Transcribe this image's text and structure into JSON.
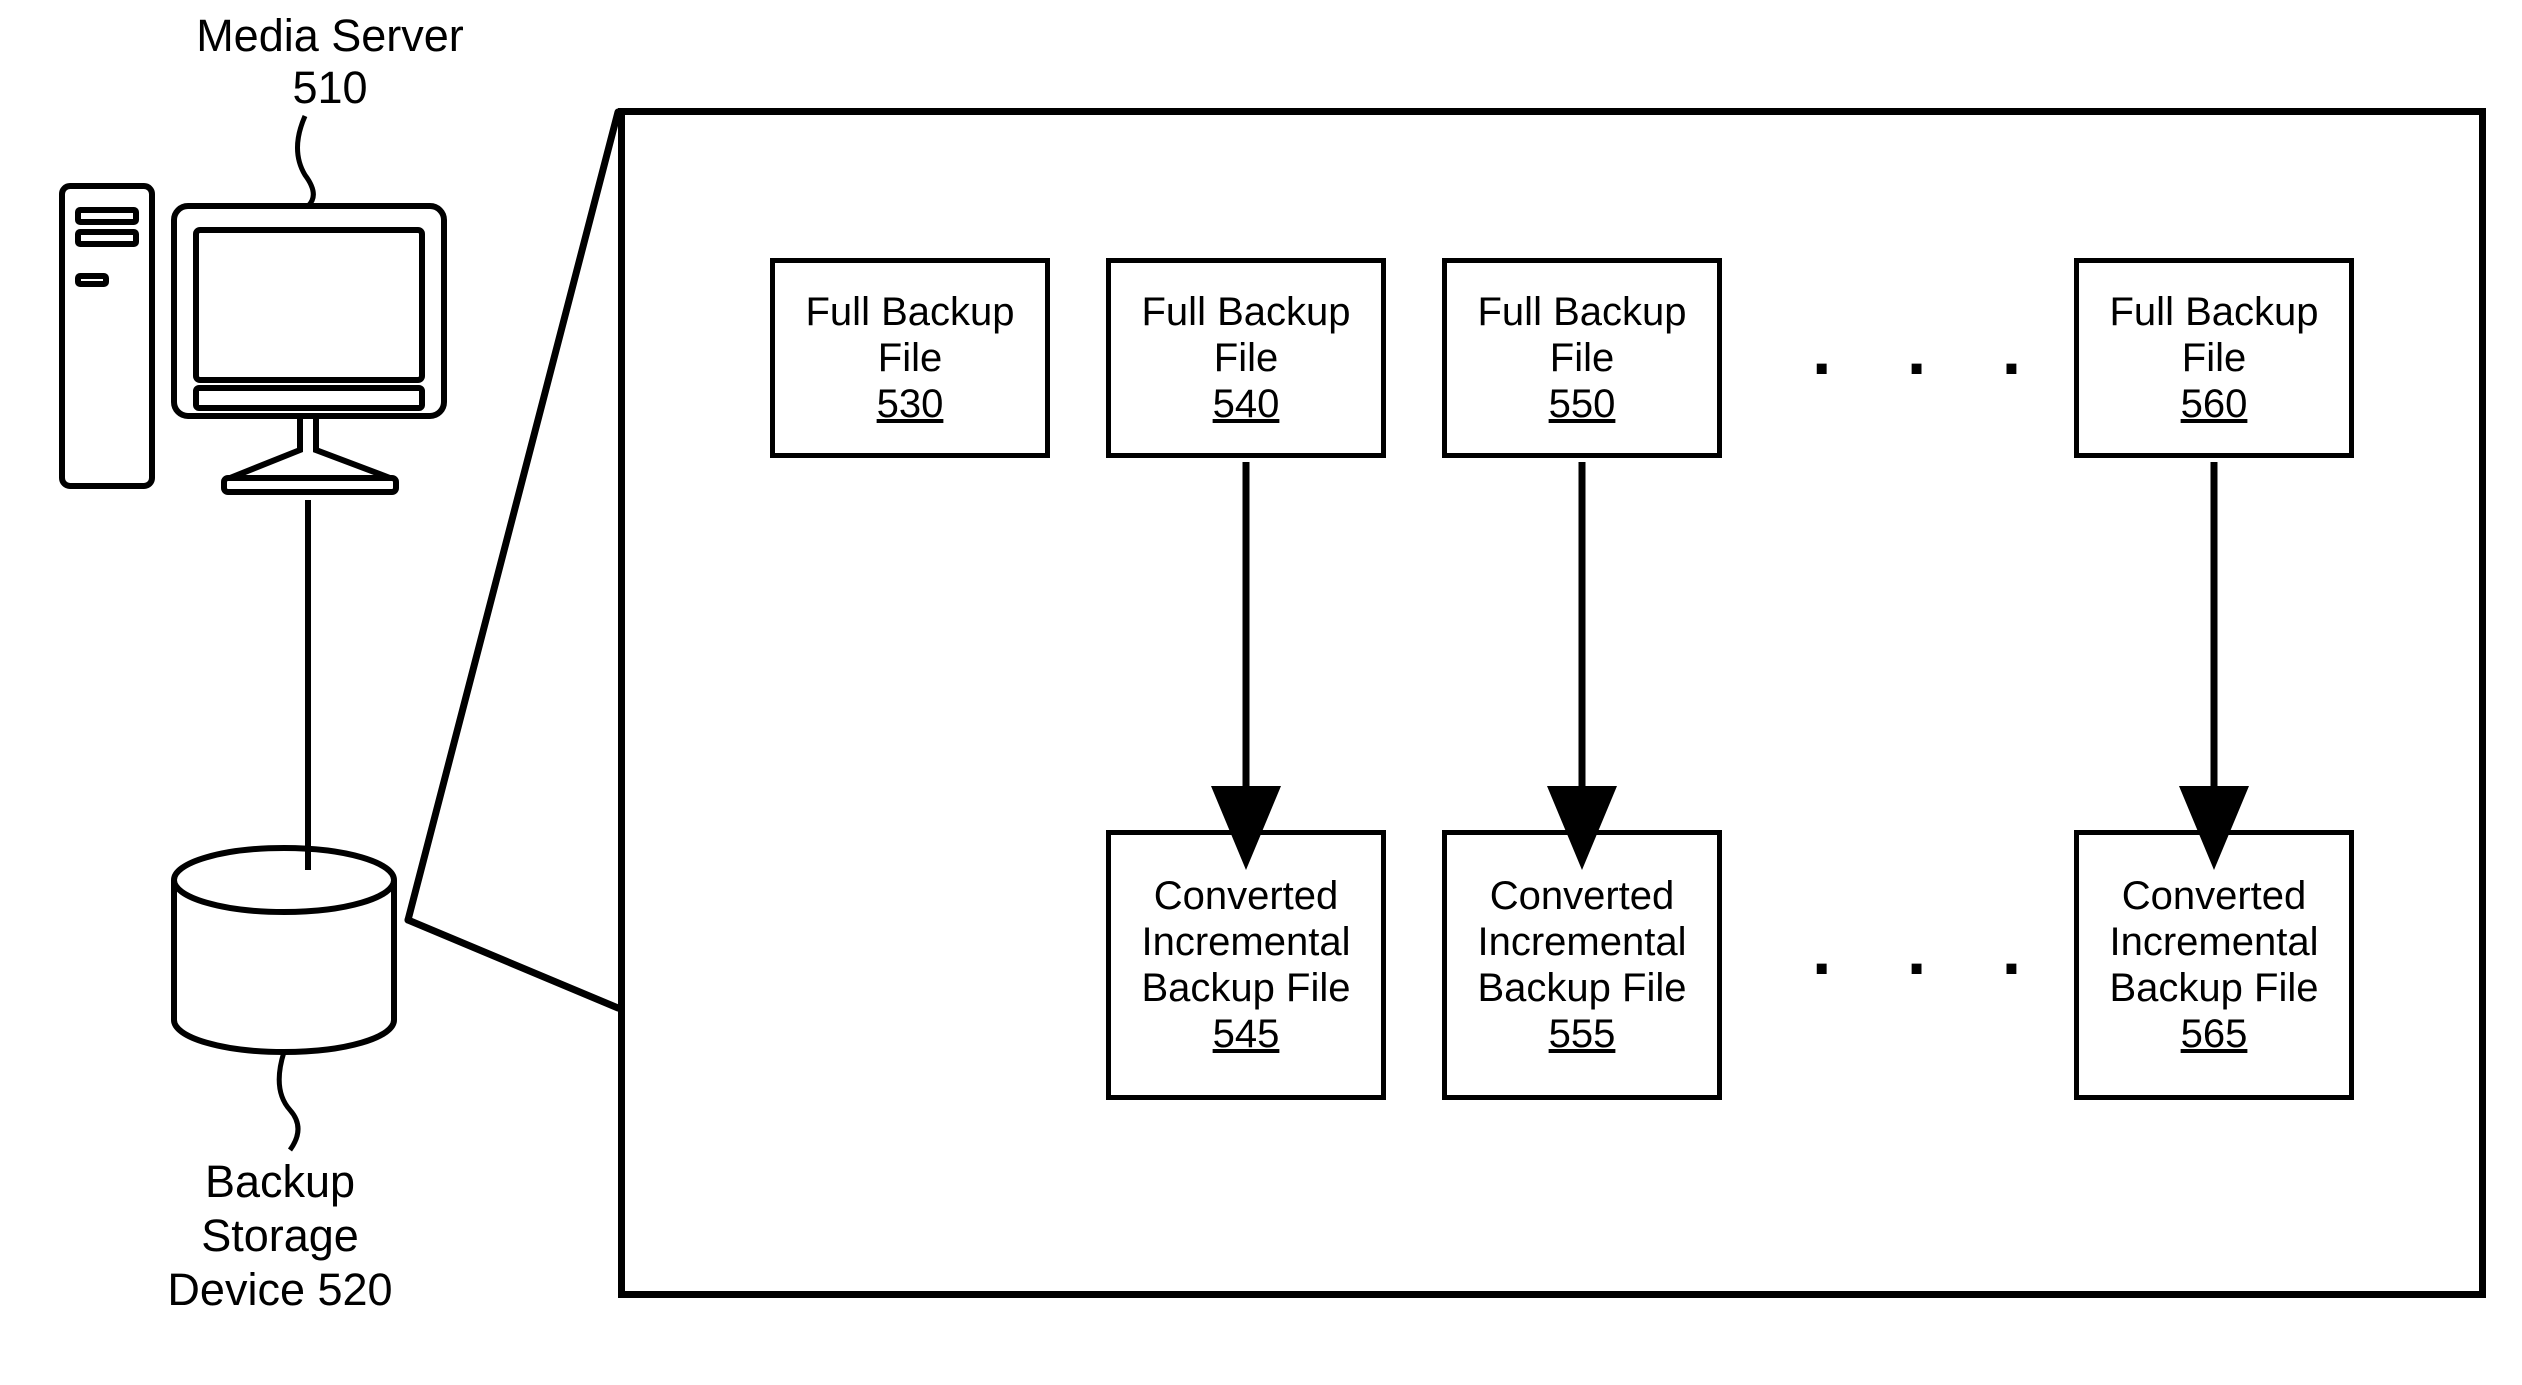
{
  "labels": {
    "media_server": "Media Server\n510",
    "backup_storage": "Backup\nStorage\nDevice 520"
  },
  "boxes": {
    "full1": {
      "title": "Full Backup\nFile",
      "ref": "530"
    },
    "full2": {
      "title": "Full Backup\nFile",
      "ref": "540"
    },
    "full3": {
      "title": "Full Backup\nFile",
      "ref": "550"
    },
    "full4": {
      "title": "Full Backup\nFile",
      "ref": "560"
    },
    "conv2": {
      "title": "Converted\nIncremental\nBackup File",
      "ref": "545"
    },
    "conv3": {
      "title": "Converted\nIncremental\nBackup File",
      "ref": "555"
    },
    "conv4": {
      "title": "Converted\nIncremental\nBackup File",
      "ref": "565"
    }
  },
  "ellipsis": ". . .",
  "diagram": {
    "type": "block-diagram",
    "nodes": [
      {
        "id": "media_server_510",
        "label": "Media Server 510"
      },
      {
        "id": "backup_storage_520",
        "label": "Backup Storage Device 520"
      },
      {
        "id": "full_530",
        "label": "Full Backup File 530"
      },
      {
        "id": "full_540",
        "label": "Full Backup File 540"
      },
      {
        "id": "full_550",
        "label": "Full Backup File 550"
      },
      {
        "id": "full_560",
        "label": "Full Backup File 560"
      },
      {
        "id": "conv_545",
        "label": "Converted Incremental Backup File 545"
      },
      {
        "id": "conv_555",
        "label": "Converted Incremental Backup File 555"
      },
      {
        "id": "conv_565",
        "label": "Converted Incremental Backup File 565"
      }
    ],
    "edges": [
      {
        "from": "media_server_510",
        "to": "backup_storage_520",
        "directed": false
      },
      {
        "from": "backup_storage_520",
        "to": "panel",
        "note": "callout",
        "directed": false
      },
      {
        "from": "full_540",
        "to": "conv_545",
        "directed": true
      },
      {
        "from": "full_550",
        "to": "conv_555",
        "directed": true
      },
      {
        "from": "full_560",
        "to": "conv_565",
        "directed": true
      }
    ],
    "sequences": [
      {
        "series": [
          "full_530",
          "full_540",
          "full_550",
          "...",
          "full_560"
        ]
      },
      {
        "series": [
          "conv_545",
          "conv_555",
          "...",
          "conv_565"
        ]
      }
    ]
  }
}
